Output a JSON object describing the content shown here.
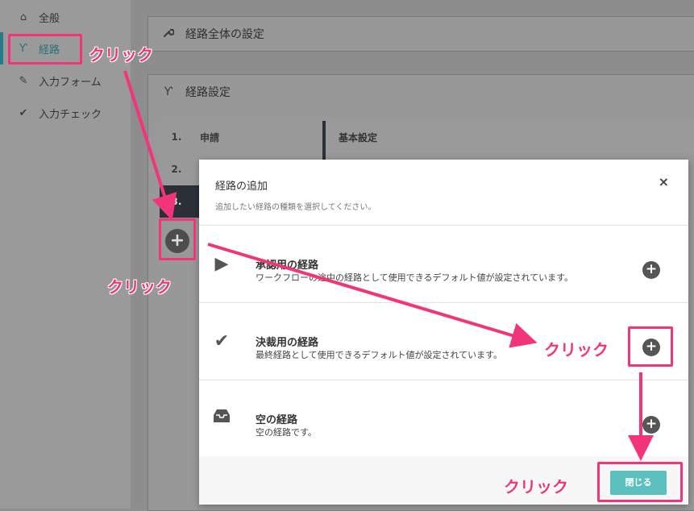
{
  "sidebar": {
    "items": [
      {
        "icon": "home-icon",
        "glyph": "⌂",
        "label": "全般"
      },
      {
        "icon": "route-icon",
        "glyph": "Ƴ",
        "label": "経路"
      },
      {
        "icon": "pencil-icon",
        "glyph": "✎",
        "label": "入力フォーム"
      },
      {
        "icon": "check-icon",
        "glyph": "✔",
        "label": "入力チェック"
      }
    ]
  },
  "panels": {
    "overall": {
      "icon": "wrench-icon",
      "glyph": "🔧",
      "title": "経路全体の設定"
    },
    "route": {
      "icon": "route-icon",
      "glyph": "Ƴ",
      "title": "経路設定"
    }
  },
  "route_table": {
    "rows": [
      {
        "num": "1.",
        "name": "申請"
      },
      {
        "num": "2.",
        "name": ""
      },
      {
        "num": "3.",
        "name": ""
      }
    ],
    "detail_header": "基本設定",
    "add_glyph": "+"
  },
  "modal": {
    "title": "経路の追加",
    "subtitle": "追加したい経路の種類を選択してください。",
    "close_glyph": "×",
    "options": [
      {
        "icon": "play-icon",
        "glyph": "▶",
        "title": "承認用の経路",
        "desc": "ワークフローの途中の経路として使用できるデフォルト値が設定されています。",
        "add": "+"
      },
      {
        "icon": "check-icon",
        "glyph": "✔",
        "title": "決裁用の経路",
        "desc": "最終経路として使用できるデフォルト値が設定されています。",
        "add": "+"
      },
      {
        "icon": "inbox-icon",
        "glyph": "▭",
        "title": "空の経路",
        "desc": "空の経路です。",
        "add": "+"
      }
    ],
    "close_label": "閉じる"
  },
  "annotations": {
    "click1": "クリック",
    "click2": "クリック",
    "click3": "クリック",
    "click4": "クリック",
    "color": "#f2357a"
  }
}
